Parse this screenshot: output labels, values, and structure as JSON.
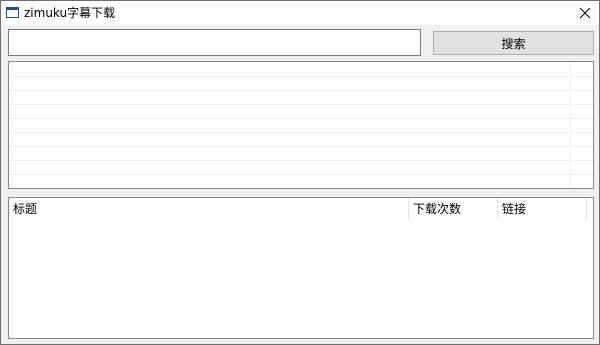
{
  "window": {
    "title": "zimuku字幕下载"
  },
  "search": {
    "value": "",
    "button_label": "搜索"
  },
  "results_list": {
    "items": []
  },
  "table": {
    "columns": [
      "标题",
      "下载次数",
      "链接"
    ],
    "rows": []
  }
}
